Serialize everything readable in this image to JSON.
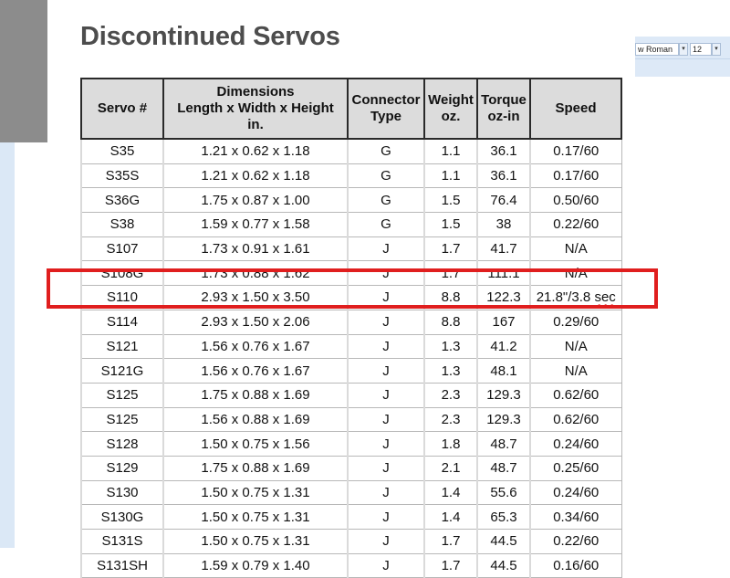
{
  "page": {
    "title": "Discontinued Servos"
  },
  "toolbar": {
    "font_name": "w Roman",
    "font_size": "12",
    "dropdown_glyph": "▾"
  },
  "table": {
    "headers": {
      "servo": "Servo #",
      "dim_line1": "Dimensions",
      "dim_line2": "Length x Width x Height",
      "dim_line3": "in.",
      "conn_line1": "Connector",
      "conn_line2": "Type",
      "weight_line1": "Weight",
      "weight_line2": "oz.",
      "torque_line1": "Torque",
      "torque_line2": "oz-in",
      "speed": "Speed"
    },
    "rows": [
      {
        "servo": "S35",
        "dims": "1.21 x 0.62 x 1.18",
        "conn": "G",
        "weight": "1.1",
        "torque": "36.1",
        "speed": "0.17/60"
      },
      {
        "servo": "S35S",
        "dims": "1.21 x 0.62 x 1.18",
        "conn": "G",
        "weight": "1.1",
        "torque": "36.1",
        "speed": "0.17/60"
      },
      {
        "servo": "S36G",
        "dims": "1.75 x 0.87 x 1.00",
        "conn": "G",
        "weight": "1.5",
        "torque": "76.4",
        "speed": "0.50/60"
      },
      {
        "servo": "S38",
        "dims": "1.59 x 0.77 x 1.58",
        "conn": "G",
        "weight": "1.5",
        "torque": "38",
        "speed": "0.22/60"
      },
      {
        "servo": "S107",
        "dims": "1.73 x 0.91 x 1.61",
        "conn": "J",
        "weight": "1.7",
        "torque": "41.7",
        "speed": "N/A"
      },
      {
        "servo": "S108G",
        "dims": "1.73 x 0.88 x 1.62",
        "conn": "J",
        "weight": "1.7",
        "torque": "111.1",
        "speed": "N/A"
      },
      {
        "servo": "S110",
        "dims": "2.93 x 1.50 x 3.50",
        "conn": "J",
        "weight": "8.8",
        "torque": "122.3",
        "speed_a": "21.8\"/3.8 ",
        "speed_b": "sec"
      },
      {
        "servo": "S114",
        "dims": "2.93 x 1.50 x 2.06",
        "conn": "J",
        "weight": "8.8",
        "torque": "167",
        "speed": "0.29/60"
      },
      {
        "servo": "S121",
        "dims": "1.56 x 0.76 x 1.67",
        "conn": "J",
        "weight": "1.3",
        "torque": "41.2",
        "speed": "N/A"
      },
      {
        "servo": "S121G",
        "dims": "1.56 x 0.76 x 1.67",
        "conn": "J",
        "weight": "1.3",
        "torque": "48.1",
        "speed": "N/A"
      },
      {
        "servo": "S125",
        "dims": "1.75 x 0.88 x 1.69",
        "conn": "J",
        "weight": "2.3",
        "torque": "129.3",
        "speed": "0.62/60"
      },
      {
        "servo": "S125",
        "dims": "1.56 x 0.88 x 1.69",
        "conn": "J",
        "weight": "2.3",
        "torque": "129.3",
        "speed": "0.62/60"
      },
      {
        "servo": "S128",
        "dims": "1.50 x 0.75 x 1.56",
        "conn": "J",
        "weight": "1.8",
        "torque": "48.7",
        "speed": "0.24/60"
      },
      {
        "servo": "S129",
        "dims": "1.75 x 0.88 x 1.69",
        "conn": "J",
        "weight": "2.1",
        "torque": "48.7",
        "speed": "0.25/60"
      },
      {
        "servo": "S130",
        "dims": "1.50 x 0.75 x 1.31",
        "conn": "J",
        "weight": "1.4",
        "torque": "55.6",
        "speed": "0.24/60"
      },
      {
        "servo": "S130G",
        "dims": "1.50 x 0.75 x 1.31",
        "conn": "J",
        "weight": "1.4",
        "torque": "65.3",
        "speed": "0.34/60"
      },
      {
        "servo": "S131S",
        "dims": "1.50 x 0.75 x 1.31",
        "conn": "J",
        "weight": "1.7",
        "torque": "44.5",
        "speed": "0.22/60"
      },
      {
        "servo": "S131SH",
        "dims": "1.59 x 0.79 x 1.40",
        "conn": "J",
        "weight": "1.7",
        "torque": "44.5",
        "speed": "0.16/60"
      }
    ]
  },
  "colors": {
    "highlight": "#e01e1e",
    "header_bg": "#dcdcdc",
    "sidebar_strip": "#dbe8f6",
    "gray_block": "#8c8c8c"
  }
}
